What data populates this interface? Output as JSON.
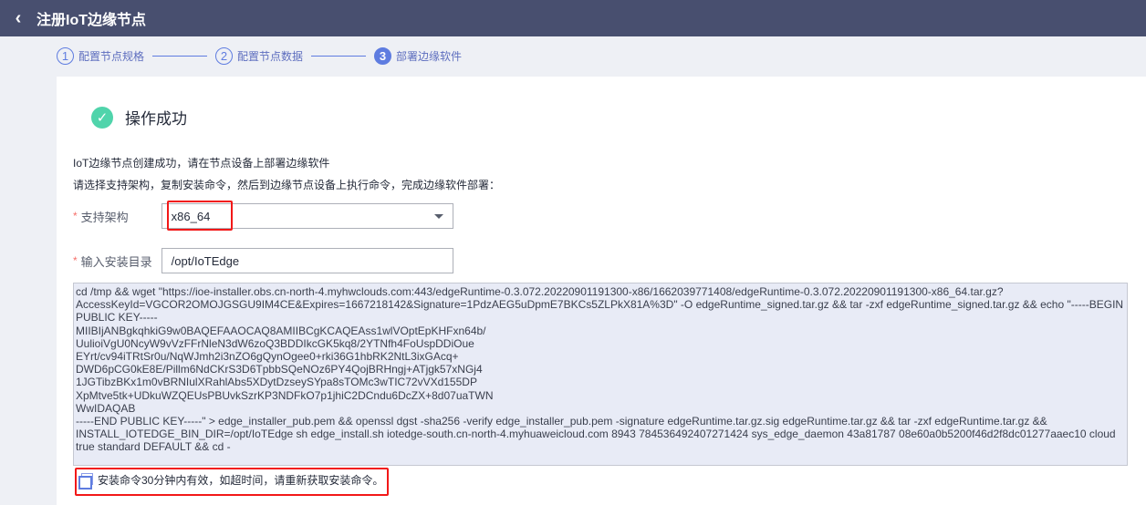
{
  "header": {
    "back_icon": "chevron-left-icon",
    "title": "注册IoT边缘节点"
  },
  "steps": [
    {
      "num": "1",
      "label": "配置节点规格"
    },
    {
      "num": "2",
      "label": "配置节点数据"
    },
    {
      "num": "3",
      "label": "部署边缘软件"
    }
  ],
  "success": {
    "icon": "check-circle-icon",
    "title": "操作成功",
    "color": "#50d4ab"
  },
  "desc1": "IoT边缘节点创建成功，请在节点设备上部署边缘软件",
  "desc2": "请选择支持架构，复制安装命令，然后到边缘节点设备上执行命令，完成边缘软件部署：",
  "form": {
    "required_mark": "*",
    "arch_label": "支持架构",
    "arch_value": "x86_64",
    "dir_label": "输入安装目录",
    "dir_value": "/opt/IoTEdge"
  },
  "command_lines": [
    "cd /tmp && wget \"https://ioe-installer.obs.cn-north-4.myhwclouds.com:443/edgeRuntime-0.3.072.20220901191300-x86/1662039771408/edgeRuntime-0.3.072.20220901191300-x86_64.tar.gz?",
    "AccessKeyId=VGCOR2OMOJGSGU9IM4CE&Expires=1667218142&Signature=1PdzAEG5uDpmE7BKCs5ZLPkX81A%3D\" -O edgeRuntime_signed.tar.gz && tar -zxf edgeRuntime_signed.tar.gz && echo \"-----BEGIN",
    "PUBLIC KEY-----",
    "MIIBIjANBgkqhkiG9w0BAQEFAAOCAQ8AMIIBCgKCAQEAss1wlVOptEpKHFxn64b/",
    "UulioiVgU0NcyW9vVzFFrNleN3dW6zoQ3BDDIkcGK5kq8/2YTNfh4FoUspDDiOue",
    "EYrt/cv94iTRtSr0u/NqWJmh2i3nZO6gQynOgee0+rki36G1hbRK2NtL3ixGAcq+",
    "DWD6pCG0kE8E/Pillm6NdCKrS3D6TpbbSQeNOz6PY4QojBRHngj+ATjgk57xNGj4",
    "1JGTibzBKx1m0vBRNIulXRahlAbs5XDytDzseySYpa8sTOMc3wTIC72vVXd155DP",
    "XpMtve5tk+UDkuWZQEUsPBUvkSzrKP3NDFkO7p1jhiC2DCndu6DcZX+8d07uaTWN",
    "WwIDAQAB",
    "-----END PUBLIC KEY-----\" > edge_installer_pub.pem && openssl dgst -sha256 -verify edge_installer_pub.pem -signature edgeRuntime.tar.gz.sig edgeRuntime.tar.gz && tar -zxf edgeRuntime.tar.gz &&",
    "INSTALL_IOTEDGE_BIN_DIR=/opt/IoTEdge sh edge_install.sh iotedge-south.cn-north-4.myhuaweicloud.com 8943 784536492407271424 sys_edge_daemon 43a81787 08e60a0b5200f46d2f8dc01277aaec10 cloud",
    "true standard DEFAULT && cd -"
  ],
  "tip": {
    "icon": "copy-icon",
    "text": "安装命令30分钟内有效，如超时间，请重新获取安装命令。"
  }
}
